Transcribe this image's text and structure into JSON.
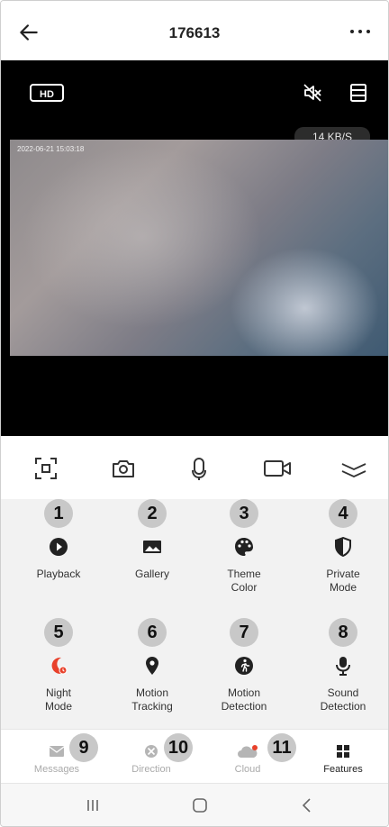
{
  "header": {
    "title": "176613",
    "back_icon": "arrow-left-icon",
    "more_icon": "more-horizontal-icon"
  },
  "video": {
    "hd_label": "HD",
    "speed": "14 KB/S",
    "timestamp": "2022-06-21 15:03:18"
  },
  "controls": [
    {
      "name": "screenshot-frame-icon"
    },
    {
      "name": "camera-snapshot-icon"
    },
    {
      "name": "microphone-icon"
    },
    {
      "name": "video-record-icon"
    },
    {
      "name": "collapse-chevron-icon"
    }
  ],
  "features": [
    {
      "number": "1",
      "label": "Playback",
      "icon": "play-circle-icon",
      "color": "#222222"
    },
    {
      "number": "2",
      "label": "Gallery",
      "icon": "gallery-icon",
      "color": "#222222"
    },
    {
      "number": "3",
      "label": "Theme Color",
      "icon": "palette-icon",
      "color": "#222222"
    },
    {
      "number": "4",
      "label": "Private Mode",
      "icon": "shield-half-icon",
      "color": "#222222"
    },
    {
      "number": "5",
      "label": "Night Mode",
      "icon": "moon-icon",
      "color": "#e8412b"
    },
    {
      "number": "6",
      "label": "Motion Tracking",
      "icon": "location-pin-icon",
      "color": "#222222"
    },
    {
      "number": "7",
      "label": "Motion Detection",
      "icon": "walking-person-icon",
      "color": "#222222"
    },
    {
      "number": "8",
      "label": "Sound Detection",
      "icon": "microphone-stand-icon",
      "color": "#222222"
    }
  ],
  "bottom_nav": [
    {
      "number": "9",
      "label": "Messages",
      "icon": "envelope-icon"
    },
    {
      "number": "10",
      "label": "Direction",
      "icon": "direction-pad-icon"
    },
    {
      "number": "11",
      "label": "Cloud",
      "icon": "cloud-icon"
    },
    {
      "number": "",
      "label": "Features",
      "icon": "grid-icon"
    }
  ],
  "system_nav": [
    {
      "name": "recent-apps-icon"
    },
    {
      "name": "home-icon"
    },
    {
      "name": "back-chevron-icon"
    }
  ],
  "colors": {
    "accent_red": "#e8412b",
    "grey_circle": "#c8c8c8"
  }
}
